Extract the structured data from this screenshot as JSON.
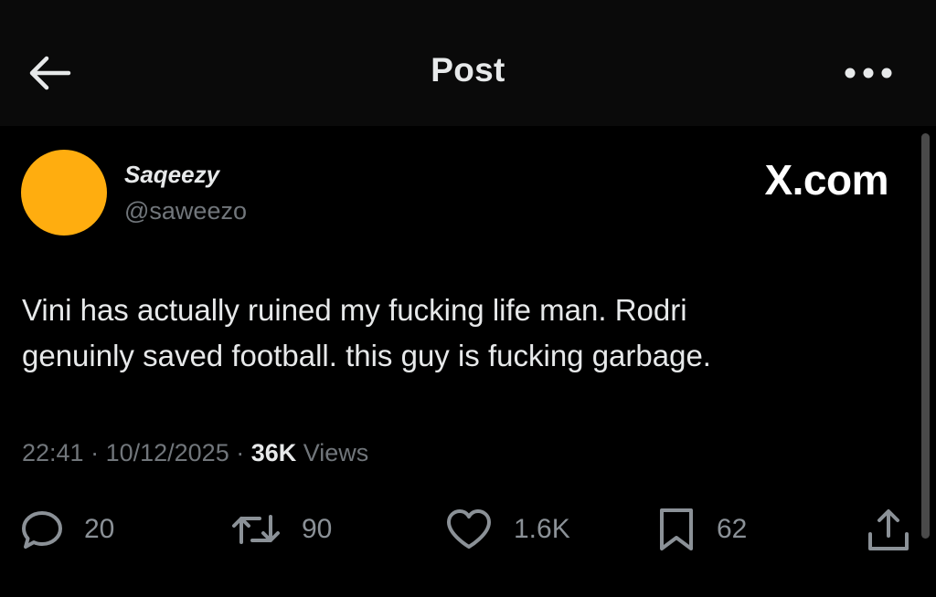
{
  "header": {
    "title": "Post",
    "back_icon": "arrow-left-icon",
    "more_icon": "more-horizontal-icon"
  },
  "author": {
    "display_name": "Saqeezy",
    "handle": "@saweezo",
    "avatar_color": "#ffad0f"
  },
  "watermark": "X.com",
  "tweet": {
    "line1": "Vini has actually ruined my fucking life man. Rodri",
    "line2": "genuinly saved football. this guy is fucking garbage."
  },
  "meta": {
    "time": "22:41",
    "separator": "·",
    "date": "10/12/2025",
    "views_count": "36K",
    "views_label": "Views"
  },
  "actions": {
    "replies": "20",
    "reposts": "90",
    "likes": "1.6K",
    "bookmarks": "62"
  },
  "colors": {
    "background": "#000000",
    "header_bg": "#0a0a0a",
    "text_primary": "#e7e9ea",
    "text_secondary": "#71767b"
  }
}
